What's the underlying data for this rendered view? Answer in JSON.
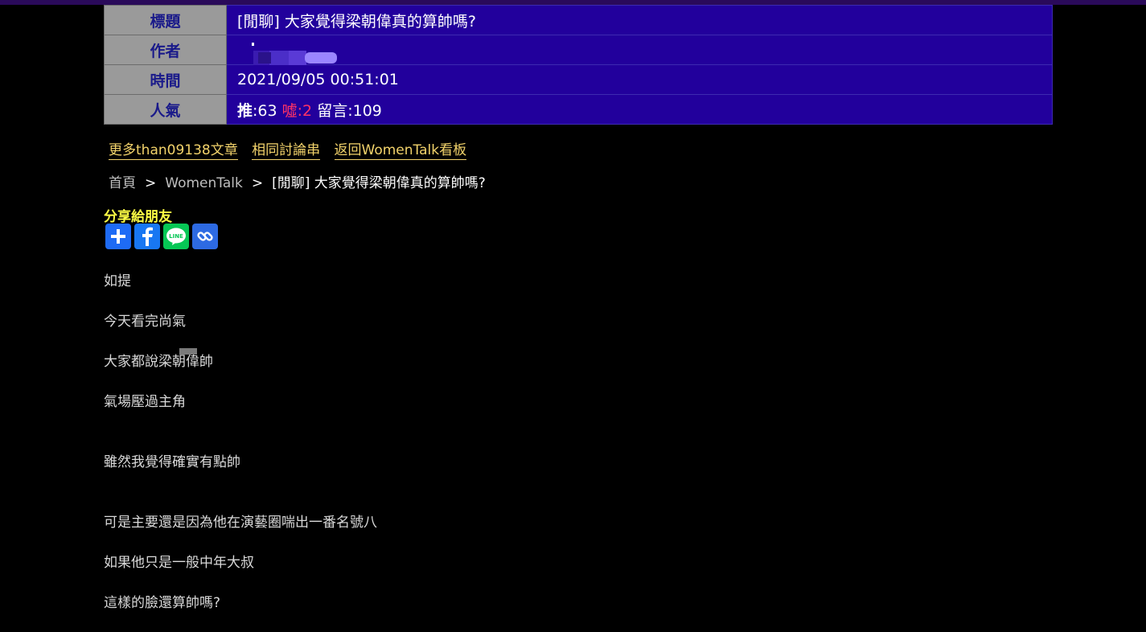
{
  "meta": {
    "rows": [
      {
        "key": "標題",
        "value": "[閒聊] 大家覺得梁朝偉真的算帥嗎?"
      },
      {
        "key": "作者",
        "value": ""
      },
      {
        "key": "時間",
        "value": "2021/09/05 00:51:01"
      },
      {
        "key": "人氣",
        "value": ""
      }
    ],
    "popularity": {
      "push_label": "推",
      "push_count": ":63",
      "boo_label": "噓",
      "boo_count": ":2",
      "comment_label": "留言:109"
    }
  },
  "links": [
    "更多than09138文章",
    "相同討論串",
    "返回WomenTalk看板"
  ],
  "breadcrumb": {
    "home": "首頁",
    "board": "WomenTalk",
    "separator": ">",
    "current": "[閒聊] 大家覺得梁朝偉真的算帥嗎?"
  },
  "share": {
    "label": "分享給朋友",
    "icons": [
      "add-icon",
      "facebook-icon",
      "line-icon",
      "link-icon"
    ],
    "line_text": "LINE"
  },
  "content": {
    "lines": [
      "如提",
      "今天看完尚氣",
      "大家都說梁朝偉帥",
      "氣場壓過主角",
      "雖然我覺得確實有點帥",
      "可是主要還是因為他在演藝圈喘出一番名號八",
      "如果他只是一般中年大叔",
      "這樣的臉還算帥嗎?"
    ]
  },
  "colors": {
    "key_bg": "#9a9a9a",
    "value_bg": "#22009c",
    "link": "#f3d36b",
    "boo": "#ff3366",
    "share_label": "#ffff44"
  }
}
